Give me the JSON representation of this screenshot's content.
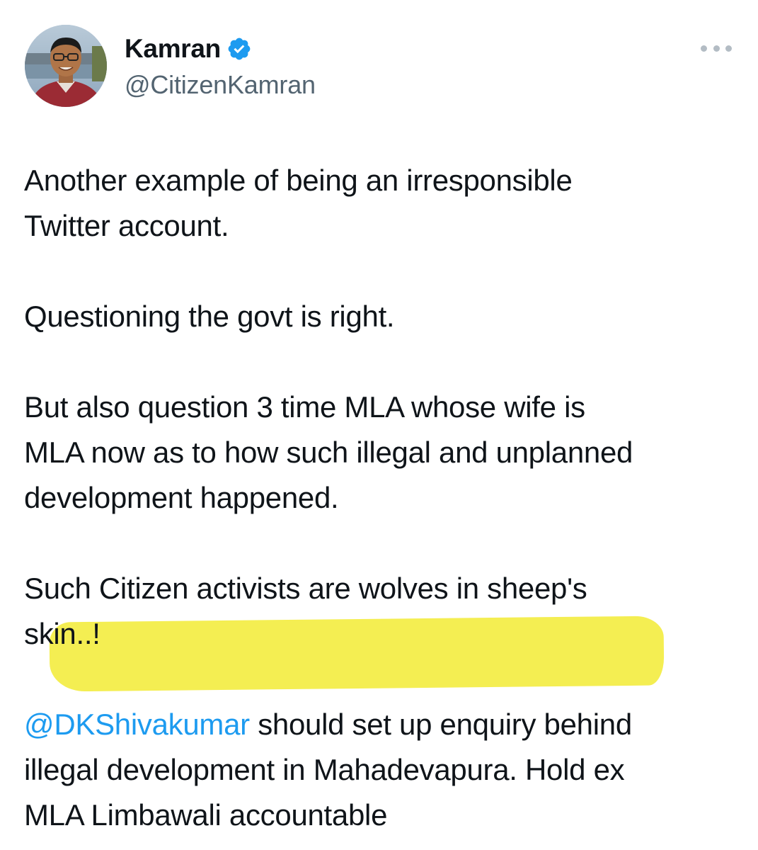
{
  "author": {
    "display_name": "Kamran",
    "handle": "@CitizenKamran",
    "verified_icon": "verified-badge-icon",
    "verified_color": "#1d9bf0"
  },
  "more_icon": "more-options-icon",
  "tweet": {
    "paragraph1": [
      "Another example of being an irresponsible",
      "Twitter account."
    ],
    "paragraph2": [
      "Questioning the govt is right."
    ],
    "paragraph3": [
      "But also question 3 time MLA whose wife is",
      "MLA now as to how such illegal and unplanned",
      "development happened."
    ],
    "paragraph4": [
      "Such Citizen activists are wolves in sheep's",
      "skin..!"
    ],
    "mention": "@DKShivakumar",
    "paragraph5": [
      " should set up enquiry behind",
      "illegal development in Mahadevapura. Hold ex",
      "MLA Limbawali accountable"
    ]
  },
  "colors": {
    "text": "#0f1419",
    "secondary": "#536471",
    "link": "#1d9bf0",
    "highlighter": "#f3ec3a"
  }
}
